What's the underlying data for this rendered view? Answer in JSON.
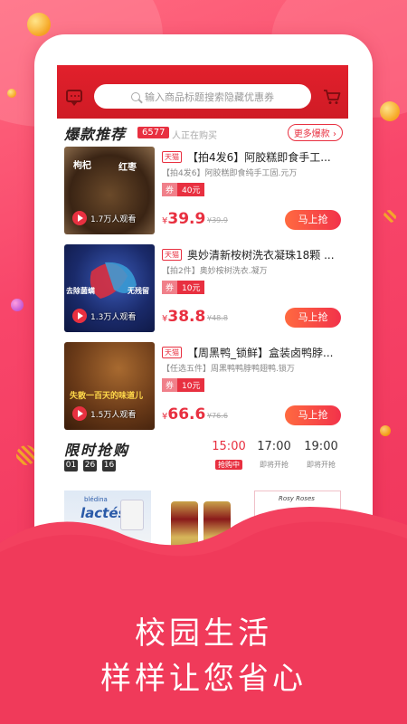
{
  "header": {
    "search_placeholder": "输入商品标题搜索隐藏优惠券"
  },
  "hot": {
    "title": "爆款推荐",
    "count": "6577",
    "people_text": "人正在购买",
    "more_label": "更多爆款"
  },
  "products": [
    {
      "badge": "天猫",
      "title": "【拍4发6】阿胶糕即食手工...",
      "subtitle": "【拍4发6】阿胶糕即食纯手工固.元万",
      "coupon_label": "券",
      "coupon_value": "40元",
      "currency": "¥",
      "price": "39.9",
      "original_price": "¥39.9",
      "views": "1.7万人观看",
      "buy_label": "马上抢",
      "overlay_a": "枸杞",
      "overlay_b": "红枣"
    },
    {
      "badge": "天猫",
      "title": "奥妙清新桉树洗衣凝珠18颗 ...",
      "subtitle": "【拍2件】奥妙桉树洗衣.凝万",
      "coupon_label": "券",
      "coupon_value": "10元",
      "currency": "¥",
      "price": "38.8",
      "original_price": "¥48.8",
      "views": "1.3万人观看",
      "buy_label": "马上抢",
      "overlay_a": "去除菌螨",
      "overlay_b": "无残留"
    },
    {
      "badge": "天猫",
      "title": "【周黑鸭_锁鲜】盒装卤鸭脖...",
      "subtitle": "【任选五件】周黑鸭鸭脖鸭翅鸭.锁万",
      "coupon_label": "券",
      "coupon_value": "10元",
      "currency": "¥",
      "price": "66.6",
      "original_price": "¥76.6",
      "views": "1.5万人观看",
      "buy_label": "马上抢",
      "overlay_a": "失散一百天的味道儿",
      "overlay_b": ""
    }
  ],
  "flash": {
    "title": "限时抢购",
    "timer": [
      "01",
      "26",
      "16"
    ],
    "slots": [
      {
        "time": "15:00",
        "status": "抢购中"
      },
      {
        "time": "17:00",
        "status": "即将开抢"
      },
      {
        "time": "19:00",
        "status": "即将开抢"
      }
    ]
  },
  "preview_texts": {
    "p1_brand": "blédina",
    "p1_name": "lactés",
    "p3_brand": "Rosy Roses"
  },
  "slogan": {
    "line1": "校园生活",
    "line2": "样样让您省心"
  },
  "colors": {
    "accent": "#e83040",
    "header": "#d91e28",
    "background": "#f5436a"
  }
}
